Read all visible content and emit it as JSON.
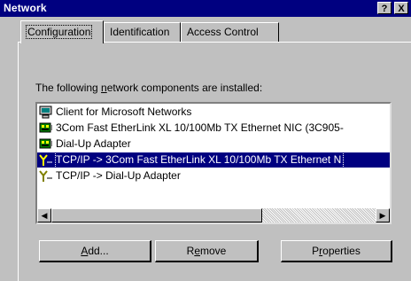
{
  "window": {
    "title": "Network",
    "help_label": "?",
    "close_label": "X"
  },
  "tabs": [
    {
      "label": "Configuration",
      "active": true
    },
    {
      "label": "Identification",
      "active": false
    },
    {
      "label": "Access Control",
      "active": false
    }
  ],
  "components": {
    "label": "The following network components are installed:",
    "items": [
      {
        "label": "Client for Microsoft Networks",
        "icon": "client-icon",
        "selected": false
      },
      {
        "label": "3Com Fast EtherLink XL 10/100Mb TX Ethernet NIC (3C905-",
        "icon": "network-card-icon",
        "selected": false
      },
      {
        "label": "Dial-Up Adapter",
        "icon": "network-card-icon",
        "selected": false
      },
      {
        "label": "TCP/IP -> 3Com Fast EtherLink XL 10/100Mb TX Ethernet N",
        "icon": "protocol-icon",
        "selected": true
      },
      {
        "label": "TCP/IP -> Dial-Up Adapter",
        "icon": "protocol-icon",
        "selected": false
      }
    ]
  },
  "buttons": {
    "add": "Add...",
    "remove": "Remove",
    "properties": "Properties"
  },
  "colors": {
    "titlebar": "#000080",
    "selection": "#000080",
    "face": "#c0c0c0"
  }
}
